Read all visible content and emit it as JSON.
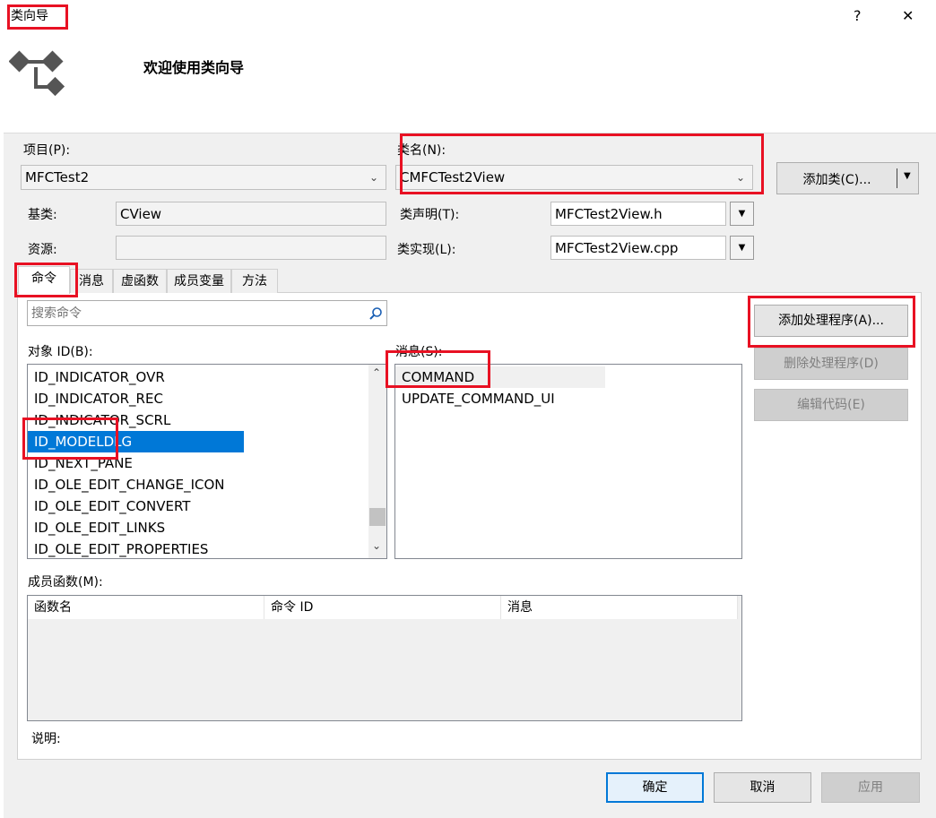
{
  "window": {
    "title": "类向导",
    "help_glyph": "?",
    "close_glyph": "✕"
  },
  "header": {
    "welcome": "欢迎使用类向导"
  },
  "project": {
    "label": "项目(P):",
    "value": "MFCTest2"
  },
  "class_name": {
    "label": "类名(N):",
    "value": "CMFCTest2View"
  },
  "add_class_button": "添加类(C)...",
  "base_class": {
    "label": "基类:",
    "value": "CView"
  },
  "resource": {
    "label": "资源:",
    "value": ""
  },
  "class_decl": {
    "label": "类声明(T):",
    "value": "MFCTest2View.h"
  },
  "class_impl": {
    "label": "类实现(L):",
    "value": "MFCTest2View.cpp"
  },
  "tabs": [
    {
      "label": "命令",
      "active": true
    },
    {
      "label": "消息"
    },
    {
      "label": "虚函数"
    },
    {
      "label": "成员变量"
    },
    {
      "label": "方法"
    }
  ],
  "search": {
    "placeholder": "搜索命令"
  },
  "object_ids": {
    "label": "对象 ID(B):",
    "items": [
      "ID_INDICATOR_OVR",
      "ID_INDICATOR_REC",
      "ID_INDICATOR_SCRL",
      "ID_MODELDLG",
      "ID_NEXT_PANE",
      "ID_OLE_EDIT_CHANGE_ICON",
      "ID_OLE_EDIT_CONVERT",
      "ID_OLE_EDIT_LINKS",
      "ID_OLE_EDIT_PROPERTIES"
    ],
    "selected": "ID_MODELDLG"
  },
  "messages": {
    "label": "消息(S):",
    "items": [
      "COMMAND",
      "UPDATE_COMMAND_UI"
    ],
    "selected": "COMMAND"
  },
  "actions": {
    "add_handler": "添加处理程序(A)...",
    "delete_handler": "删除处理程序(D)",
    "edit_code": "编辑代码(E)"
  },
  "member_functions": {
    "label": "成员函数(M):",
    "columns": [
      "函数名",
      "命令 ID",
      "消息"
    ]
  },
  "description": {
    "label": "说明:"
  },
  "footer": {
    "ok": "确定",
    "cancel": "取消",
    "apply": "应用"
  },
  "colors": {
    "highlight_red": "#e81123",
    "selection_blue": "#0078d7",
    "panel_bg": "#f0f0f0"
  }
}
